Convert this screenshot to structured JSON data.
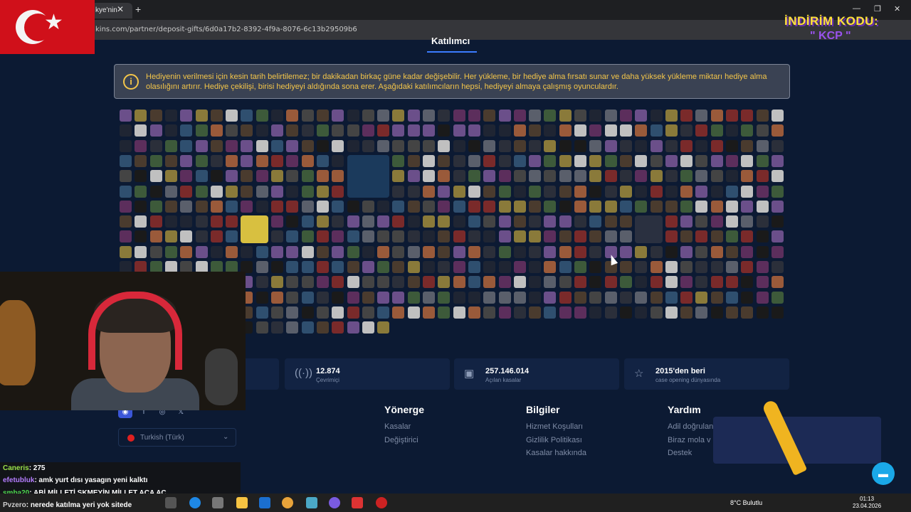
{
  "browser": {
    "tab_title": "kye'nin",
    "url": "kins.com/partner/deposit-gifts/6d0a17b2-8392-4f9a-8076-6c13b29509b6"
  },
  "overlay": {
    "promo_title": "İNDİRİM KODU:",
    "promo_code": "\" KCP \""
  },
  "page": {
    "section_title": "Katılımcı",
    "notice": "Hediyenin verilmesi için kesin tarih belirtilemez; bir dakikadan birkaç güne kadar değişebilir. Her yükleme, bir hediye alma fırsatı sunar ve daha yüksek yükleme miktarı hediye alma olasılığını artırır. Hediye çekilişi, birisi hediyeyi aldığında sona erer. Aşağıdaki katılımcıların hepsi, hediyeyi almaya çalışmış oyunculardır."
  },
  "stats": [
    {
      "value": "12.874",
      "label": "Çevrimiçi",
      "icon": "broadcast-icon"
    },
    {
      "value": "257.146.014",
      "label": "Açılan kasalar",
      "icon": "box-icon"
    },
    {
      "value": "2015'den beri",
      "label": "case opening dünyasında",
      "icon": "star-icon"
    }
  ],
  "footer": {
    "col1": {
      "head": "Yönerge",
      "links": [
        "Kasalar",
        "Değiştirici"
      ]
    },
    "col2": {
      "head": "Bilgiler",
      "links": [
        "Hizmet Koşulları",
        "Gizlilik Politikası",
        "Kasalar hakkında"
      ]
    },
    "col3": {
      "head": "Yardım",
      "links": [
        "Adil doğrulan",
        "Biraz mola v",
        "Destek"
      ]
    },
    "language": "Turkish (Türk)"
  },
  "chat": {
    "line1_user": "Caneris",
    "line1_msg": ": 275",
    "line2_user": "efetubluk",
    "line2_msg": ": amk yurt dısı yasagın yeni kalktı",
    "line3_user": "smba20",
    "line3_msg": ": ABİ MİLLETİ SKMEYİN MİLLET ACA AC",
    "line4_user": "Pvzero",
    "line4_msg": ": nerede katılma yeri yok sitede"
  },
  "taskbar": {
    "weather": "8°C  Bulutlu",
    "time": "01:13",
    "date": "23.04.2026"
  }
}
